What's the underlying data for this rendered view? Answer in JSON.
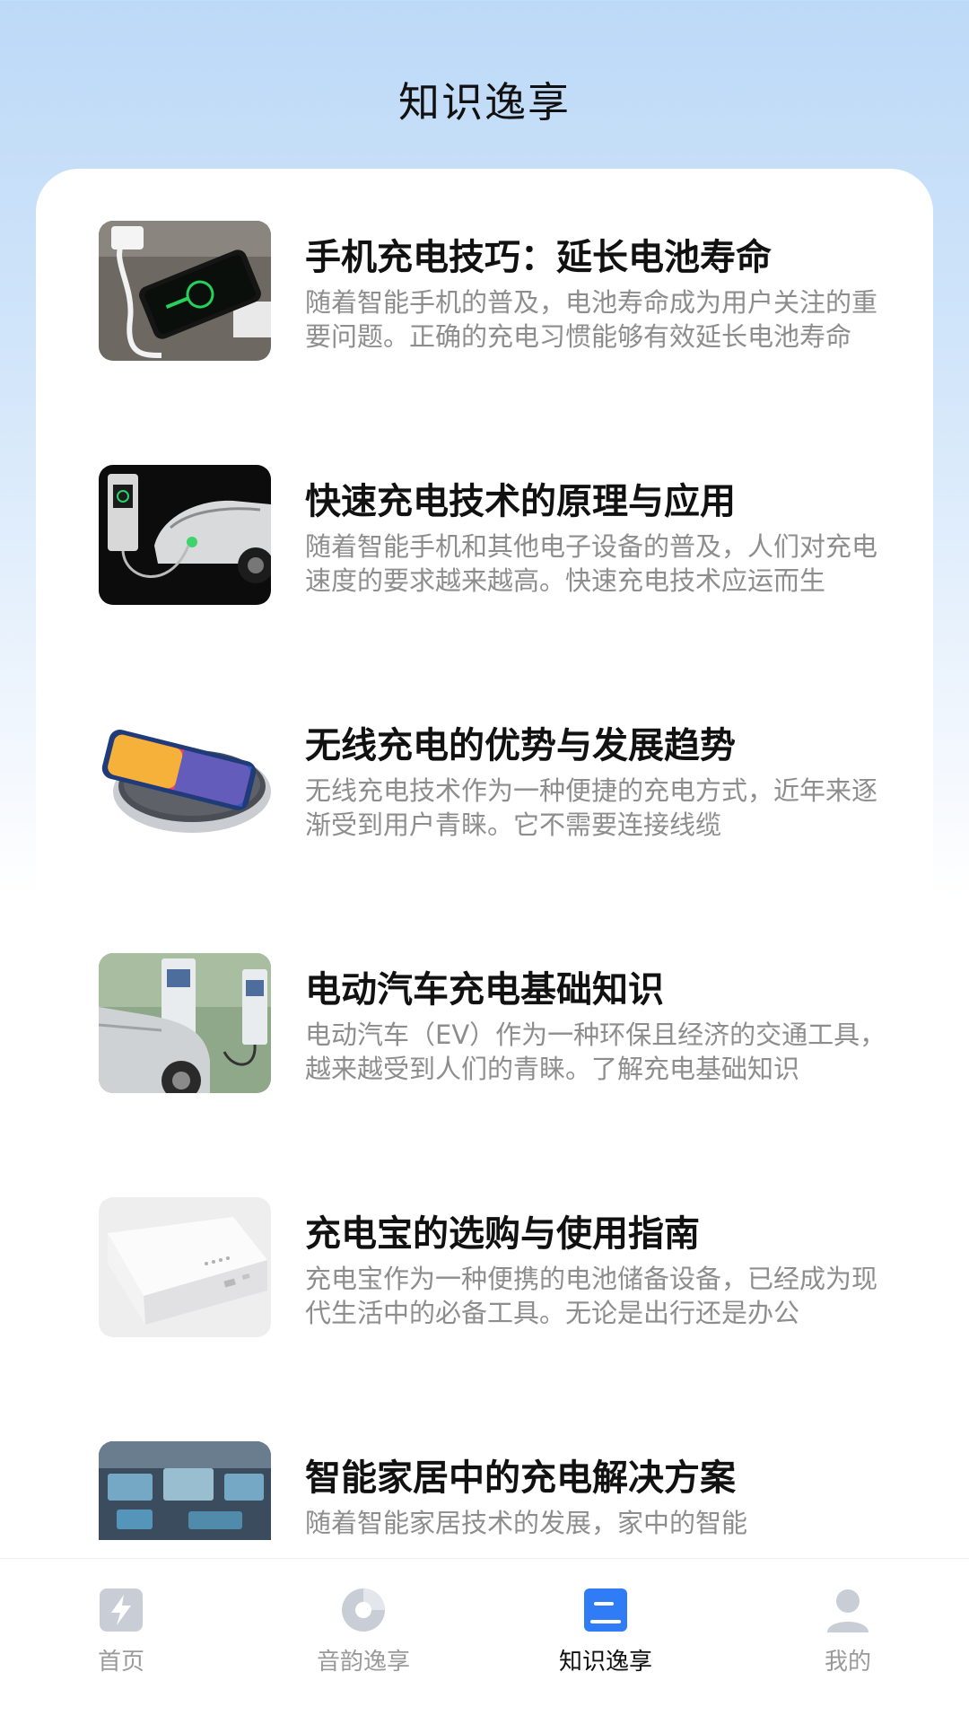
{
  "header": {
    "title": "知识逸享"
  },
  "articles": [
    {
      "title": "手机充电技巧：延长电池寿命",
      "summary": "随着智能手机的普及，电池寿命成为用户关注的重要问题。正确的充电习惯能够有效延长电池寿命",
      "thumbnail_icon": "phone-charging-image"
    },
    {
      "title": "快速充电技术的原理与应用",
      "summary": "随着智能手机和其他电子设备的普及，人们对充电速度的要求越来越高。快速充电技术应运而生",
      "thumbnail_icon": "ev-charging-station-image"
    },
    {
      "title": "无线充电的优势与发展趋势",
      "summary": "无线充电技术作为一种便捷的充电方式，近年来逐渐受到用户青睐。它不需要连接线缆",
      "thumbnail_icon": "wireless-charger-image"
    },
    {
      "title": "电动汽车充电基础知识",
      "summary": "电动汽车（EV）作为一种环保且经济的交通工具，越来越受到人们的青睐。了解充电基础知识",
      "thumbnail_icon": "electric-car-charging-image"
    },
    {
      "title": "充电宝的选购与使用指南",
      "summary": "充电宝作为一种便携的电池储备设备，已经成为现代生活中的必备工具。无论是出行还是办公",
      "thumbnail_icon": "power-bank-image"
    },
    {
      "title": "智能家居中的充电解决方案",
      "summary": "随着智能家居技术的发展，家中的智能",
      "thumbnail_icon": "smart-home-image"
    }
  ],
  "tab_bar": {
    "items": [
      {
        "label": "首页",
        "icon": "lightning-icon",
        "active": false
      },
      {
        "label": "音韵逸享",
        "icon": "music-disc-icon",
        "active": false
      },
      {
        "label": "知识逸享",
        "icon": "book-icon",
        "active": true
      },
      {
        "label": "我的",
        "icon": "user-icon",
        "active": false
      }
    ]
  },
  "colors": {
    "accent": "#2f7cf6",
    "inactive_icon": "#c9ced6",
    "title_text": "#111111",
    "summary_text": "#8d8d8d"
  }
}
